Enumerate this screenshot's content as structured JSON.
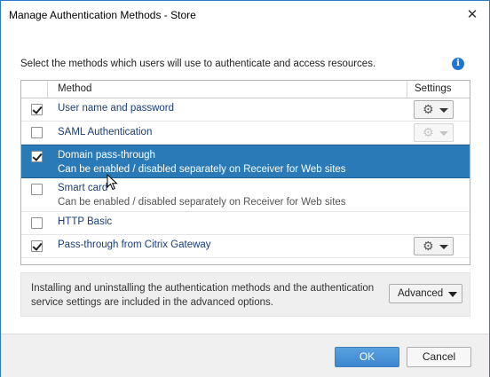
{
  "window": {
    "title": "Manage Authentication Methods - Store",
    "close_glyph": "✕"
  },
  "instruction": "Select the methods which users will use to authenticate and access resources.",
  "info_icon": {
    "name": "info-icon",
    "glyph": "i",
    "color": "#1f77d0"
  },
  "grid": {
    "headers": {
      "method": "Method",
      "settings": "Settings"
    },
    "rows": [
      {
        "name": "User name and password",
        "sub": "",
        "checked": true,
        "selected": false,
        "settings": "enabled"
      },
      {
        "name": "SAML Authentication",
        "sub": "",
        "checked": false,
        "selected": false,
        "settings": "disabled"
      },
      {
        "name": "Domain pass-through",
        "sub": "Can be enabled / disabled separately on Receiver for Web sites",
        "checked": true,
        "selected": true,
        "settings": "none"
      },
      {
        "name": "Smart card",
        "sub": "Can be enabled / disabled separately on Receiver for Web sites",
        "checked": false,
        "selected": false,
        "settings": "none"
      },
      {
        "name": "HTTP Basic",
        "sub": "",
        "checked": false,
        "selected": false,
        "settings": "none"
      },
      {
        "name": "Pass-through from Citrix Gateway",
        "sub": "",
        "checked": true,
        "selected": false,
        "settings": "enabled"
      }
    ],
    "settings_glyph": "⚙"
  },
  "info_panel": {
    "text": "Installing and uninstalling the authentication methods and the authentication service settings are included in the advanced options.",
    "advanced_label": "Advanced"
  },
  "footer": {
    "ok_label": "OK",
    "cancel_label": "Cancel"
  },
  "colors": {
    "selection": "#2a7ab8",
    "accent": "#3b86cf",
    "link_text": "#1a3d78"
  }
}
